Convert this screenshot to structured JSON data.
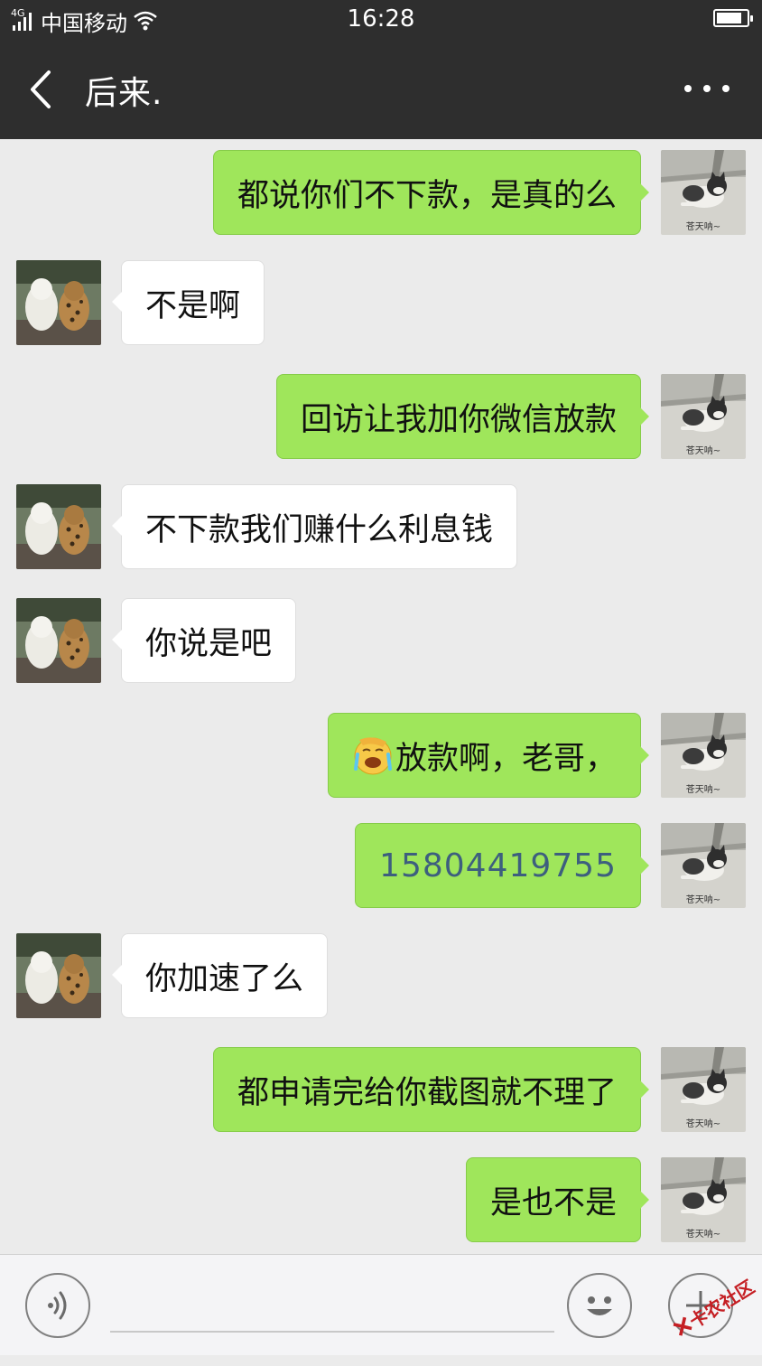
{
  "status_bar": {
    "network": "4G",
    "carrier": "中国移动",
    "time": "16:28",
    "battery_level": 0.85
  },
  "header": {
    "title": "后来.",
    "back_icon": "chevron-left-icon",
    "more_icon": "more-dots-icon"
  },
  "messages": [
    {
      "side": "right",
      "text": "都说你们不下款，是真的么"
    },
    {
      "side": "left",
      "text": "不是啊"
    },
    {
      "side": "right",
      "text": "回访让我加你微信放款"
    },
    {
      "side": "left",
      "text": "不下款我们赚什么利息钱"
    },
    {
      "side": "left",
      "text": "你说是吧"
    },
    {
      "side": "right",
      "text": "放款啊，老哥，",
      "emoji": "facepalm-emoji"
    },
    {
      "side": "right",
      "text": "15804419755"
    },
    {
      "side": "left",
      "text": "你加速了么"
    },
    {
      "side": "right",
      "text": "都申请完给你截图就不理了"
    },
    {
      "side": "right",
      "text": "是也不是"
    }
  ],
  "avatars": {
    "self_caption": "苍天呐~"
  },
  "input_bar": {
    "voice_icon": "voice-icon",
    "emoji_icon": "smiley-icon",
    "plus_icon": "plus-icon",
    "message_value": ""
  },
  "watermark": {
    "text": "卡农社区"
  },
  "colors": {
    "header_bg": "#2e2e2e",
    "chat_bg": "#ebebeb",
    "outgoing_bubble": "#9fe65b",
    "incoming_bubble": "#ffffff",
    "phone_link": "#3d5f7e",
    "watermark": "#c51f24"
  }
}
